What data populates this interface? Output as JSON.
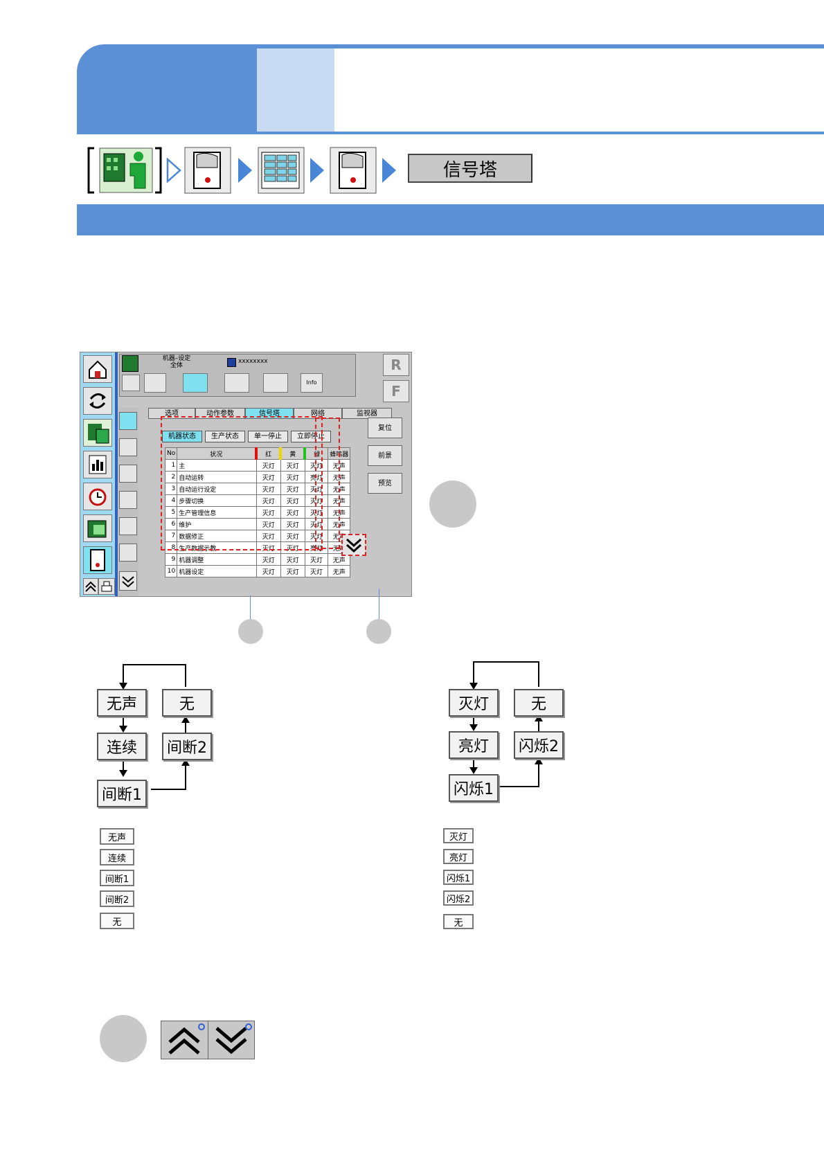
{
  "breadcrumb": {
    "icons": [
      "machine-setting-icon",
      "door-icon",
      "grid-icon",
      "door-icon"
    ],
    "current_label": "信号塔"
  },
  "screen": {
    "header_title_line1": "机器–设定",
    "header_title_line2": "全体",
    "header_id": "xxxxxxxx",
    "right_buttons": [
      "R",
      "F"
    ],
    "tabs": [
      {
        "label": "选项",
        "active": false
      },
      {
        "label": "动作参数",
        "active": false
      },
      {
        "label": "信号塔",
        "active": true
      },
      {
        "label": "网络",
        "active": false
      },
      {
        "label": "监视器",
        "active": false
      }
    ],
    "sub_tabs": [
      {
        "label": "机器状态",
        "active": true
      },
      {
        "label": "生产状态",
        "active": false
      },
      {
        "label": "单一停止",
        "active": false
      },
      {
        "label": "立即停止",
        "active": false
      }
    ],
    "table_headers": [
      "No",
      "状况",
      "红",
      "黄",
      "绿",
      "蜂鸣器"
    ],
    "rows": [
      {
        "no": "1",
        "status": "主",
        "red": "灭灯",
        "yellow": "灭灯",
        "green": "灭灯",
        "buzzer": "无声"
      },
      {
        "no": "2",
        "status": "自动运转",
        "red": "灭灯",
        "yellow": "灭灯",
        "green": "亮灯",
        "buzzer": "无声"
      },
      {
        "no": "3",
        "status": "自动运行设定",
        "red": "灭灯",
        "yellow": "灭灯",
        "green": "灭灯",
        "buzzer": "无声"
      },
      {
        "no": "4",
        "status": "步骤切换",
        "red": "灭灯",
        "yellow": "灭灯",
        "green": "灭灯",
        "buzzer": "无声"
      },
      {
        "no": "5",
        "status": "生产管理信息",
        "red": "灭灯",
        "yellow": "灭灯",
        "green": "灭灯",
        "buzzer": "无声"
      },
      {
        "no": "6",
        "status": "维护",
        "red": "灭灯",
        "yellow": "灭灯",
        "green": "灭灯",
        "buzzer": "无声"
      },
      {
        "no": "7",
        "status": "数据修正",
        "red": "灭灯",
        "yellow": "灭灯",
        "green": "灭灯",
        "buzzer": "无声"
      },
      {
        "no": "8",
        "status": "生产数据示教",
        "red": "灭灯",
        "yellow": "灭灯",
        "green": "亮灯",
        "buzzer": "无声"
      },
      {
        "no": "9",
        "status": "机器调整",
        "red": "灭灯",
        "yellow": "灭灯",
        "green": "灭灯",
        "buzzer": "无声"
      },
      {
        "no": "10",
        "status": "机器设定",
        "red": "灭灯",
        "yellow": "灭灯",
        "green": "灭灯",
        "buzzer": "无声"
      }
    ],
    "action_buttons": [
      "复位",
      "前景",
      "预览"
    ]
  },
  "buzzer_flow": [
    "无声",
    "连续",
    "间断1",
    "间断2",
    "无"
  ],
  "lamp_flow": [
    "灭灯",
    "亮灯",
    "闪烁1",
    "闪烁2",
    "无"
  ],
  "buzzer_legend": [
    "无声",
    "连续",
    "间断1",
    "间断2",
    "无"
  ],
  "lamp_legend": [
    "灭灯",
    "亮灯",
    "闪烁1",
    "闪烁2",
    "无"
  ],
  "scroll_buttons": [
    "scroll-up-icon",
    "scroll-down-icon"
  ],
  "colors": {
    "header_blue": "#5b8fd6",
    "header_light": "#c8dbf3",
    "highlight_red": "#e02020",
    "active_tab": "#7fe0f0"
  }
}
